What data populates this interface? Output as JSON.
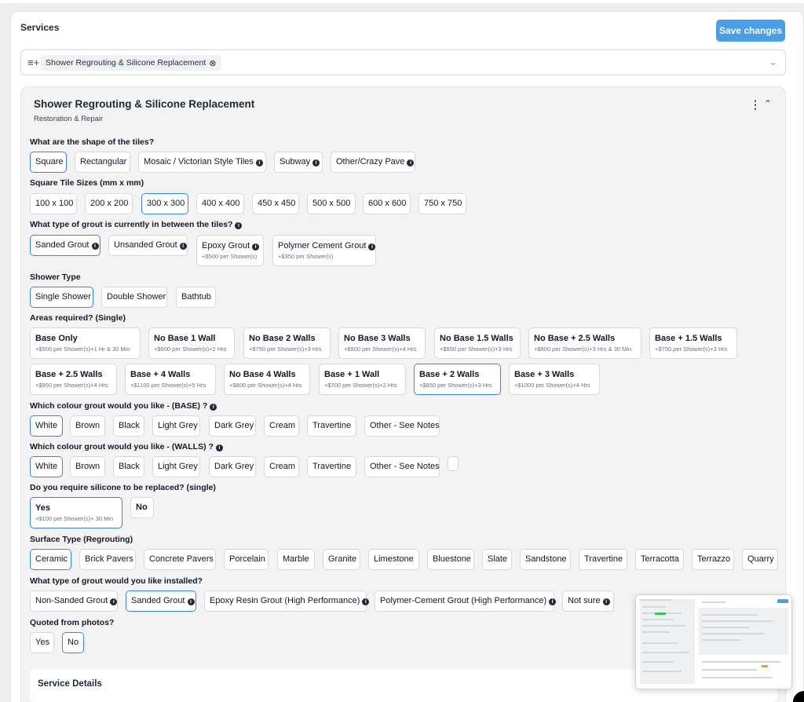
{
  "page": {
    "title": "Services",
    "save_label": "Save changes"
  },
  "selector": {
    "tag_label": "Shower Regrouting & Silicone Replacement",
    "list_icon": "list-add-icon",
    "remove_icon": "circle-x-icon",
    "chevron_icon": "chevron-down-icon"
  },
  "service": {
    "title": "Shower Regrouting & Silicone Replacement",
    "category": "Restoration & Repair",
    "menu_icon": "vertical-dots-icon",
    "collapse_icon": "chevron-up-icon",
    "details_title": "Service Details"
  },
  "questions": {
    "tile_shape": {
      "label": "What are the shape of the tiles?",
      "options": [
        "Square",
        "Rectangular",
        "Mosaic / Victorian Style Tiles",
        "Subway",
        "Other/Crazy Pave"
      ],
      "selected": "Square"
    },
    "tile_sizes": {
      "label": "Square Tile Sizes (mm x mm)",
      "options": [
        "100 x 100",
        "200 x 200",
        "300 x 300",
        "400 x 400",
        "450 x 450",
        "500 x 500",
        "600 x 600",
        "750 x 750"
      ],
      "selected": "300 x 300"
    },
    "current_grout": {
      "label": "What type of grout is currently in between the tiles?",
      "options": [
        {
          "label": "Sanded Grout",
          "price": ""
        },
        {
          "label": "Unsanded Grout",
          "price": ""
        },
        {
          "label": "Epoxy Grout",
          "price": "+$500 per Shower(s)"
        },
        {
          "label": "Polymer Cement Grout",
          "price": "+$350 per Shower(s)"
        }
      ],
      "selected": "Sanded Grout"
    },
    "shower_type": {
      "label": "Shower Type",
      "options": [
        "Single Shower",
        "Double Shower",
        "Bathtub"
      ],
      "selected": "Single Shower"
    },
    "areas": {
      "label": "Areas required? (Single)",
      "options": [
        {
          "label": "Base Only",
          "price": "+$500 per Shower(s)+1 Hr & 30 Min"
        },
        {
          "label": "No Base 1 Wall",
          "price": "+$600 per Shower(s)+2 Hrs"
        },
        {
          "label": "No Base 2 Walls",
          "price": "+$750 per Shower(s)+3 Hrs"
        },
        {
          "label": "No Base 3 Walls",
          "price": "+$900 per Shower(s)+4 Hrs"
        },
        {
          "label": "No Base 1.5 Walls",
          "price": "+$650 per Shower(s)+3 Hrs"
        },
        {
          "label": "No Base + 2.5 Walls",
          "price": "+$800 per Shower(s)+3 Hrs & 30 Min"
        },
        {
          "label": "Base + 1.5 Walls",
          "price": "+$750 per Shower(s)+3 Hrs"
        },
        {
          "label": "Base + 2.5 Walls",
          "price": "+$950 per Shower(s)+4 Hrs"
        },
        {
          "label": "Base + 4 Walls",
          "price": "+$1100 per Shower(s)+5 Hrs"
        },
        {
          "label": "No Base 4 Walls",
          "price": "+$800 per Shower(s)+4 Hrs"
        },
        {
          "label": "Base + 1 Wall",
          "price": "+$700 per Shower(s)+2 Hrs"
        },
        {
          "label": "Base + 2 Walls",
          "price": "+$850 per Shower(s)+3 Hrs"
        },
        {
          "label": "Base + 3 Walls",
          "price": "+$1000 per Shower(s)+4 Hrs"
        }
      ],
      "selected": "Base + 2 Walls"
    },
    "colour_base": {
      "label": "Which colour grout would you like - (BASE) ?",
      "options": [
        "White",
        "Brown",
        "Black",
        "Light Grey",
        "Dark Grey",
        "Cream",
        "Travertine",
        "Other - See Notes"
      ],
      "selected": "White"
    },
    "colour_walls": {
      "label": "Which colour grout would you like - (WALLS) ?",
      "options": [
        "White",
        "Brown",
        "Black",
        "Light Grey",
        "Dark Grey",
        "Cream",
        "Travertine",
        "Other - See Notes"
      ],
      "selected": "White"
    },
    "silicone": {
      "label": "Do you require silicone to be replaced? (single)",
      "options": [
        {
          "label": "Yes",
          "price": "+$100 per Shower(s)+ 30 Min"
        },
        {
          "label": "No",
          "price": ""
        }
      ],
      "selected": "Yes"
    },
    "surface": {
      "label": "Surface Type (Regrouting)",
      "options": [
        "Ceramic",
        "Brick Pavers",
        "Concrete Pavers",
        "Porcelain",
        "Marble",
        "Granite",
        "Limestone",
        "Bluestone",
        "Slate",
        "Sandstone",
        "Travertine",
        "Terracotta",
        "Terrazzo",
        "Quarry"
      ],
      "selected": "Ceramic"
    },
    "install_grout": {
      "label": "What type of grout would you like installed?",
      "options": [
        "Non-Sanded Grout",
        "Sanded Grout",
        "Epoxy Resin Grout (High Performance)",
        "Polymer-Cement Grout (High Performance)",
        "Not sure"
      ],
      "selected": "Sanded Grout"
    },
    "photos": {
      "label": "Quoted from photos?",
      "options": [
        "Yes",
        "No"
      ],
      "selected": "No"
    }
  },
  "info_icon": "info-circle-icon",
  "colors": {
    "accent": "#4a9de7",
    "selected_border": "#3b82f6",
    "panel_bg": "#f3f3f4"
  }
}
